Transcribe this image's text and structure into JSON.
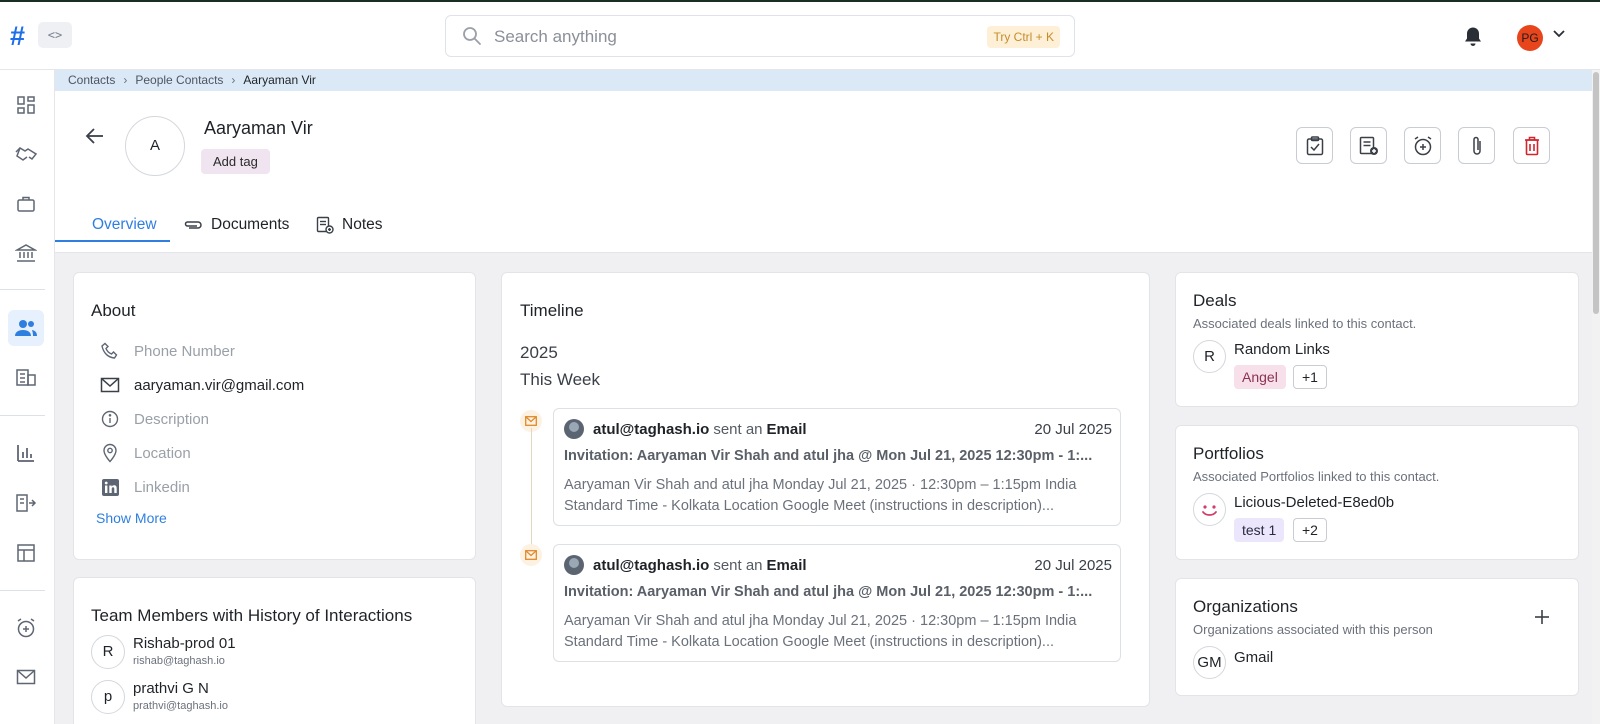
{
  "app": {
    "logo": "#",
    "code_toggle": "<>",
    "search": {
      "placeholder": "Search anything",
      "shortcut": "Try Ctrl + K"
    },
    "user_initials": "PG"
  },
  "colors": {
    "accent": "#2f7fe0",
    "logo": "#1e6fe8",
    "avatar": "#e8451c",
    "delete": "#d0262e"
  },
  "sidebar": {
    "items": [
      {
        "icon": "dashboard-icon"
      },
      {
        "icon": "handshake-icon"
      },
      {
        "icon": "briefcase-icon"
      },
      {
        "icon": "bank-icon"
      },
      {
        "icon": "contacts-icon",
        "active": true
      },
      {
        "icon": "building-icon"
      },
      {
        "icon": "bar-chart-icon"
      },
      {
        "icon": "export-icon"
      },
      {
        "icon": "table-icon"
      },
      {
        "icon": "alarm-add-icon"
      },
      {
        "icon": "mail-icon"
      }
    ]
  },
  "breadcrumb": [
    "Contacts",
    "People Contacts",
    "Aaryaman Vir"
  ],
  "contact": {
    "initial": "A",
    "name": "Aaryaman Vir",
    "add_tag": "Add tag"
  },
  "actions": [
    "task-icon",
    "add-note-icon",
    "reminder-icon",
    "attach-icon",
    "delete-icon"
  ],
  "tabs": [
    {
      "label": "Overview",
      "active": true
    },
    {
      "label": "Documents",
      "icon": "paperclip-icon"
    },
    {
      "label": "Notes",
      "icon": "notes-icon"
    }
  ],
  "about": {
    "title": "About",
    "fields": [
      {
        "icon": "phone-icon",
        "value": "Phone Number",
        "empty": true
      },
      {
        "icon": "mail-icon",
        "value": "aaryaman.vir@gmail.com",
        "empty": false
      },
      {
        "icon": "info-icon",
        "value": "Description",
        "empty": true
      },
      {
        "icon": "location-icon",
        "value": "Location",
        "empty": true
      },
      {
        "icon": "linkedin-icon",
        "value": "Linkedin",
        "empty": true
      }
    ],
    "show_more": "Show More"
  },
  "team": {
    "title": "Team Members with History of Interactions",
    "members": [
      {
        "initial": "R",
        "name": "Rishab-prod 01",
        "email": "rishab@taghash.io"
      },
      {
        "initial": "p",
        "name": "prathvi G N",
        "email": "prathvi@taghash.io"
      }
    ]
  },
  "timeline": {
    "title": "Timeline",
    "year": "2025",
    "period": "This Week",
    "items": [
      {
        "who": "atul@taghash.io",
        "action": "sent an",
        "what": "Email",
        "date": "20 Jul 2025",
        "subject": "Invitation: Aaryaman Vir Shah and atul jha @ Mon Jul 21, 2025 12:30pm - 1:...",
        "body": "Aaryaman Vir Shah and atul jha Monday Jul 21, 2025 · 12:30pm – 1:15pm India Standard Time - Kolkata Location Google Meet (instructions in description)..."
      },
      {
        "who": "atul@taghash.io",
        "action": "sent an",
        "what": "Email",
        "date": "20 Jul 2025",
        "subject": "Invitation: Aaryaman Vir Shah and atul jha @ Mon Jul 21, 2025 12:30pm - 1:...",
        "body": "Aaryaman Vir Shah and atul jha Monday Jul 21, 2025 · 12:30pm – 1:15pm India Standard Time - Kolkata Location Google Meet (instructions in description)..."
      }
    ]
  },
  "deals": {
    "title": "Deals",
    "subtitle": "Associated deals linked to this contact.",
    "item": {
      "initial": "R",
      "name": "Random Links",
      "tag": "Angel",
      "more": "+1"
    }
  },
  "portfolios": {
    "title": "Portfolios",
    "subtitle": "Associated Portfolios linked to this contact.",
    "item": {
      "name": "Licious-Deleted-E8ed0b",
      "tag": "test 1",
      "more": "+2"
    }
  },
  "organizations": {
    "title": "Organizations",
    "subtitle": "Organizations associated with this person",
    "item": {
      "initial": "GM",
      "name": "Gmail"
    }
  }
}
